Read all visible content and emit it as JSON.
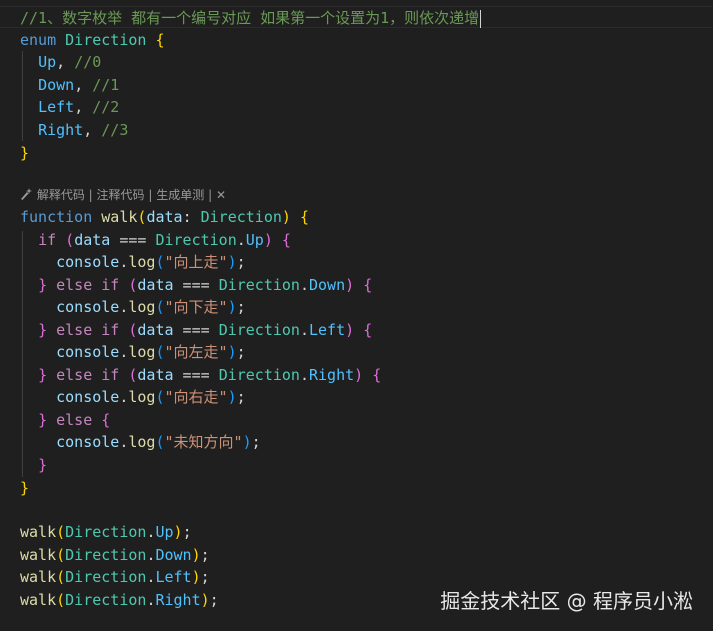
{
  "editor": {
    "comment_line": "//1、数字枚举 都有一个编号对应 如果第一个设置为1，则依次递增",
    "enum_keyword": "enum",
    "enum_name": "Direction",
    "enum_members": [
      {
        "name": "Up",
        "comment": "//0"
      },
      {
        "name": "Down",
        "comment": "//1"
      },
      {
        "name": "Left",
        "comment": "//2"
      },
      {
        "name": "Right",
        "comment": "//3"
      }
    ],
    "function_keyword": "function",
    "function_name": "walk",
    "param_name": "data",
    "param_type": "Direction",
    "log_object": "console",
    "log_method": "log",
    "keyword_if": "if",
    "keyword_else": "else",
    "messages": [
      "\"向上走\"",
      "\"向下走\"",
      "\"向左走\"",
      "\"向右走\"",
      "\"未知方向\""
    ],
    "calls": [
      "Up",
      "Down",
      "Left",
      "Right"
    ]
  },
  "codelens": {
    "icon": "sparkle-icon",
    "explain": "解释代码",
    "comment": "注释代码",
    "unit_test": "生成单测",
    "separator": "|",
    "close": "✕"
  },
  "watermark": {
    "text": "掘金技术社区 @ 程序员小淞"
  },
  "colors": {
    "background": "#1f1f1f",
    "comment": "#6a9955",
    "keyword": "#569cd6",
    "control": "#c586c0",
    "type": "#4ec9b0",
    "function": "#dcdcaa",
    "variable": "#9cdcfe",
    "enum_member": "#4fc1ff",
    "string": "#ce9178"
  }
}
